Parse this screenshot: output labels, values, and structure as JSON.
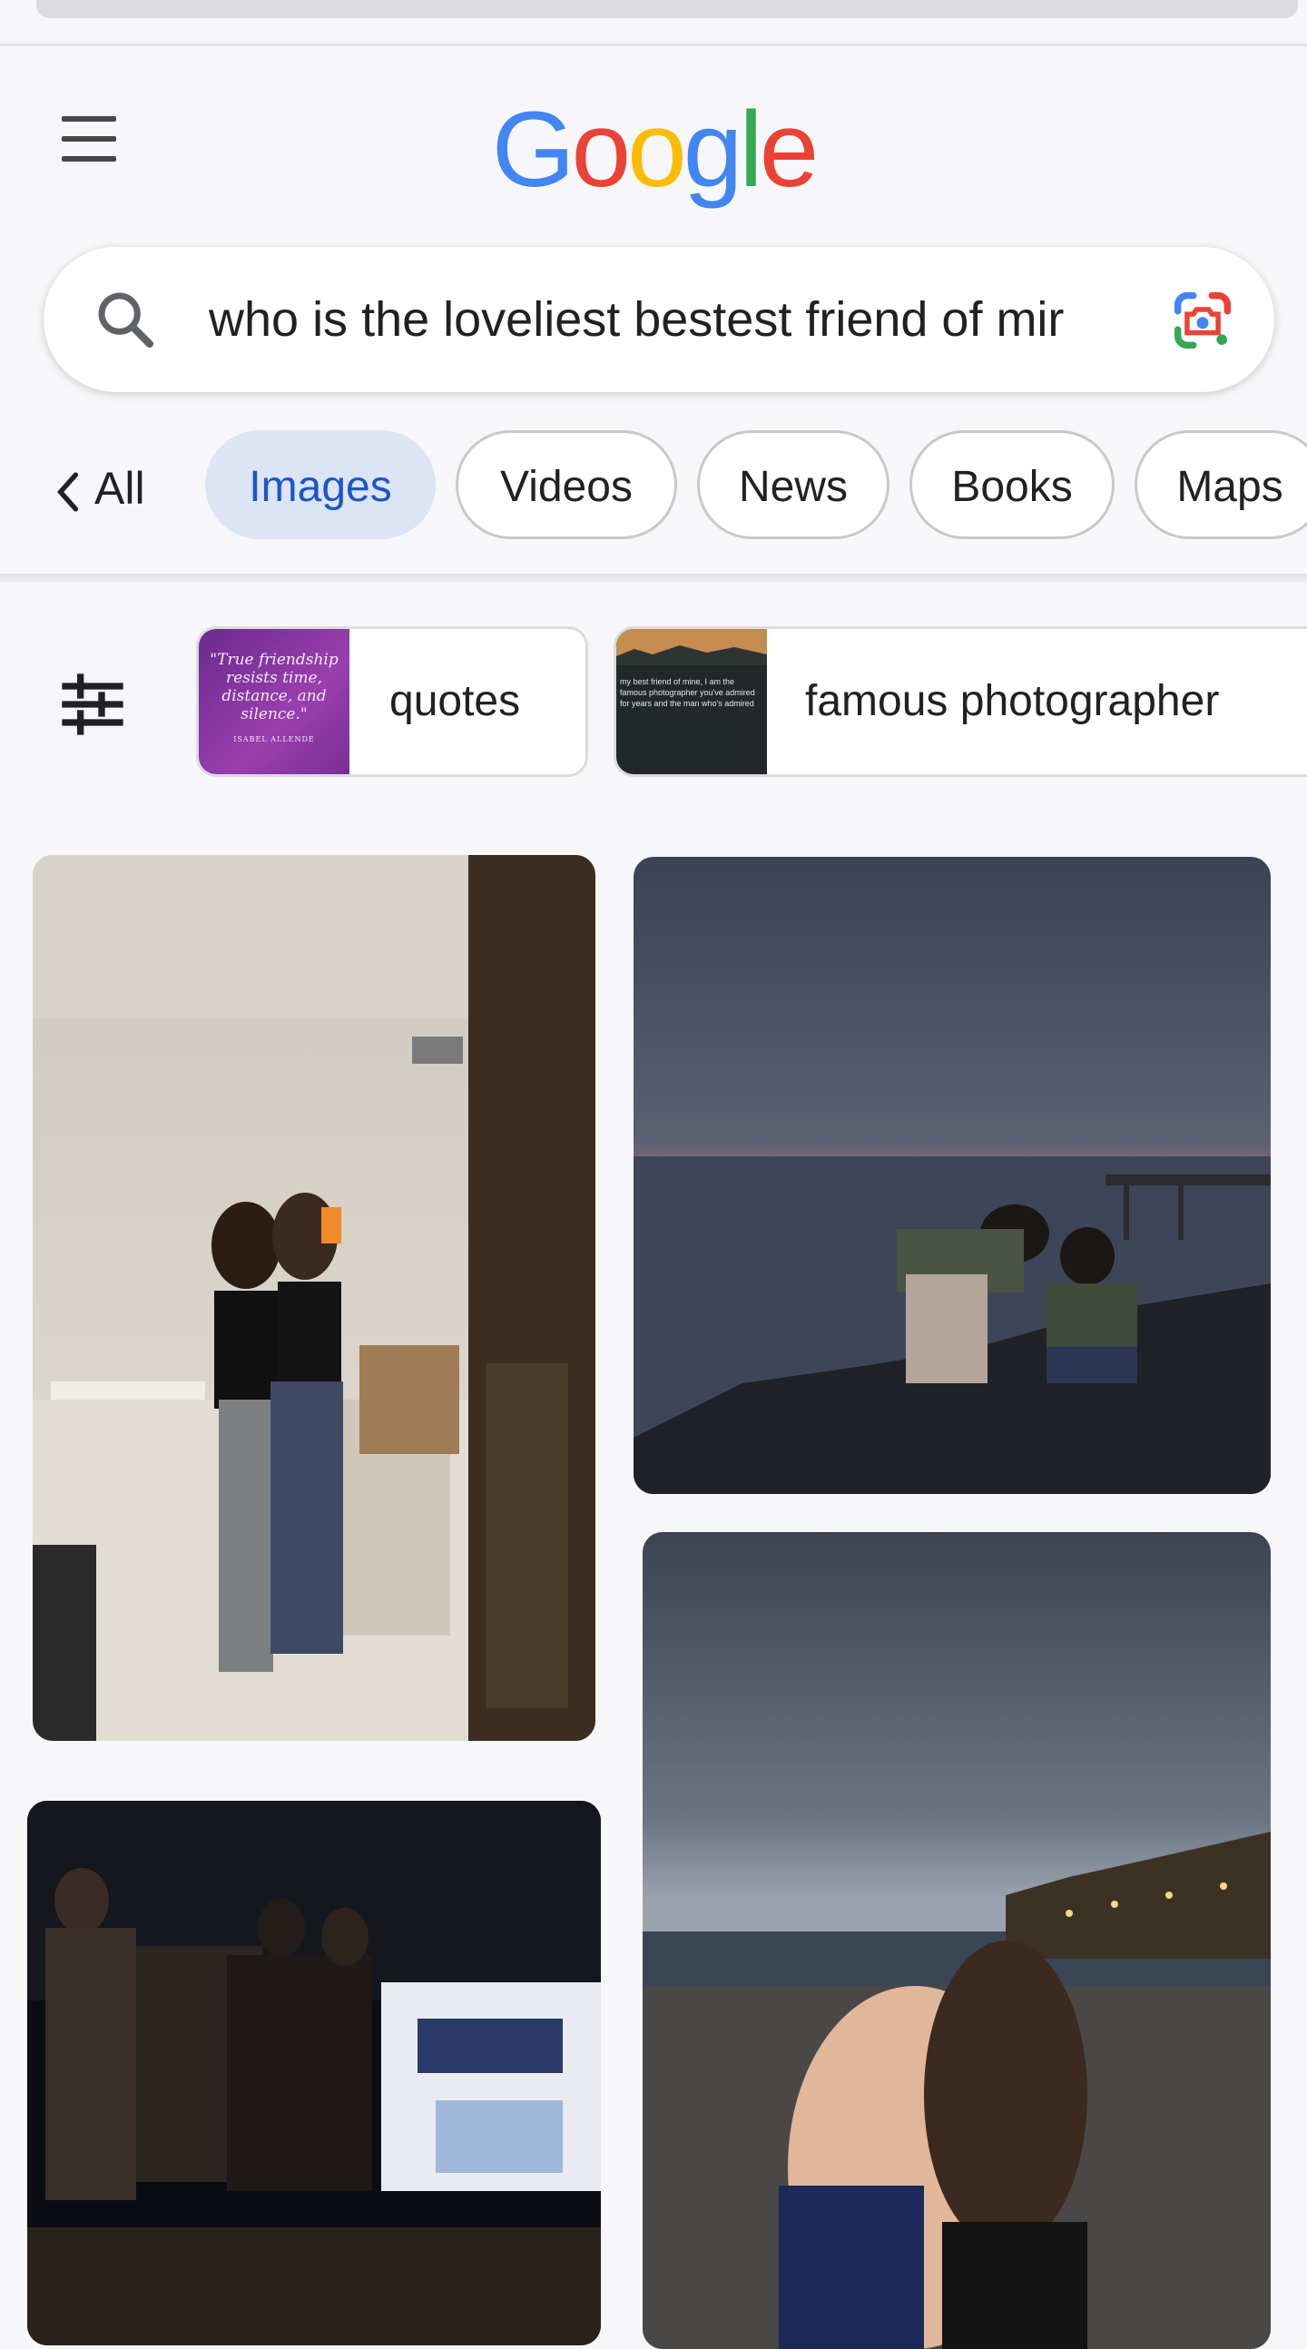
{
  "logo": {
    "letters": [
      "G",
      "o",
      "o",
      "g",
      "l",
      "e"
    ],
    "colors": [
      "#4285F4",
      "#EA4335",
      "#FBBC05",
      "#4285F4",
      "#34A853",
      "#EA4335"
    ]
  },
  "search": {
    "query": "who is the loveliest bestest friend of mir"
  },
  "tabs": [
    {
      "label": "All",
      "active": false
    },
    {
      "label": "Images",
      "active": true
    },
    {
      "label": "Videos",
      "active": false
    },
    {
      "label": "News",
      "active": false
    },
    {
      "label": "Books",
      "active": false
    },
    {
      "label": "Maps",
      "active": false
    }
  ],
  "suggestions": [
    {
      "label": "quotes",
      "thumb_text": "\"True friendship resists time, distance, and silence.\"",
      "thumb_caption": "ISABEL ALLENDE"
    },
    {
      "label": "famous photographer",
      "thumb_text": "my best friend of mine, I am the famous photographer you've admired for years and the man who's admired you"
    }
  ],
  "images": [
    {
      "name": "mirror-selfie-friends",
      "desc": "Two friends posing in front of a mirror"
    },
    {
      "name": "seaside-rocks-sunset",
      "desc": "Friends on rocks by the sea at sunset"
    },
    {
      "name": "night-street-group",
      "desc": "Group of friends on a street at night"
    },
    {
      "name": "beach-hug-night",
      "desc": "Two friends hugging on a pebble beach at dusk"
    }
  ],
  "icons": {
    "menu": "menu-icon",
    "search": "search-icon",
    "lens": "google-lens-icon",
    "back": "chevron-left-icon",
    "filter": "tune-icon"
  }
}
